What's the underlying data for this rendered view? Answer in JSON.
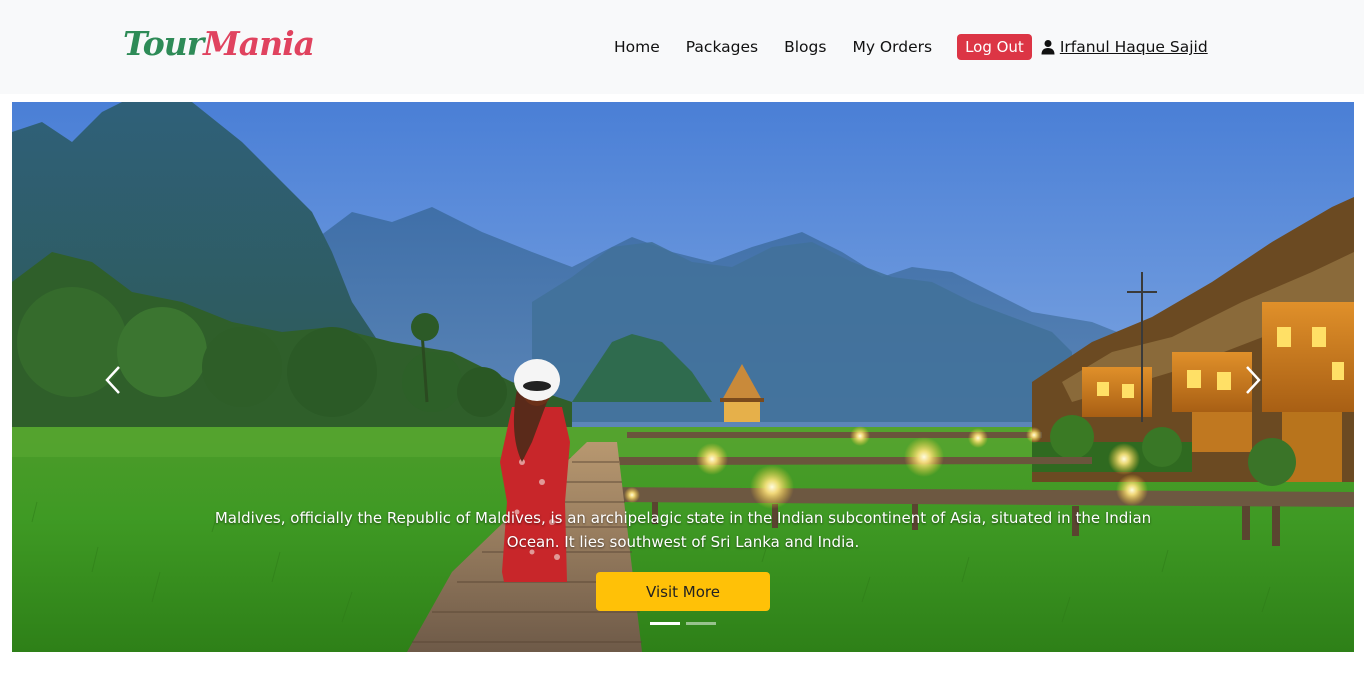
{
  "brand": {
    "part1": "Tour",
    "part2": "Mania"
  },
  "nav": {
    "links": [
      "Home",
      "Packages",
      "Blogs",
      "My Orders"
    ],
    "logout_label": "Log Out",
    "user_name": "Irfanul Haque Sajid",
    "user_icon": "user-icon"
  },
  "hero": {
    "caption": "Maldives, officially the Republic of Maldives, is an archipelagic state in the Indian subcontinent of Asia, situated in the Indian Ocean. It lies southwest of Sri Lanka and India.",
    "button_label": "Visit More",
    "slide_count": 2,
    "active_slide": 1
  },
  "colors": {
    "logo_primary": "#2e8b57",
    "logo_accent": "#e0435f",
    "logout": "#dc3545",
    "visit_button": "#ffc107",
    "navbar_bg": "#f8f9fa"
  }
}
